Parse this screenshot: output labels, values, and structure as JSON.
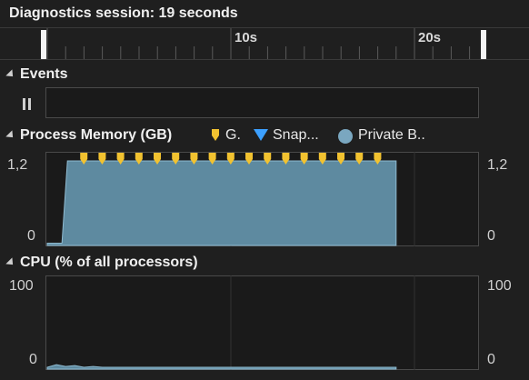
{
  "session": {
    "title": "Diagnostics session: 19 seconds"
  },
  "timeline": {
    "ticks": [
      "10s",
      "20s"
    ]
  },
  "events": {
    "title": "Events"
  },
  "memory": {
    "title": "Process Memory (GB)",
    "legend": [
      {
        "label": "G.",
        "icon": "gc-marker-icon",
        "color": "#f2c230"
      },
      {
        "label": "Snap...",
        "icon": "snapshot-icon",
        "color": "#3ca0ff"
      },
      {
        "label": "Private B..",
        "icon": "private-bytes-icon",
        "color": "#7aa7c0"
      }
    ],
    "y_top_label": "1,2",
    "y_bottom_label": "0",
    "y_top_right_label": "1,2",
    "y_bottom_right_label": "0",
    "gc_marker_count": 17
  },
  "cpu": {
    "title": "CPU (% of all processors)",
    "y_top_label": "100",
    "y_bottom_label": "0",
    "y_top_right_label": "100",
    "y_bottom_right_label": "0"
  },
  "chart_data": [
    {
      "type": "area",
      "title": "Process Memory (GB)",
      "xlabel": "",
      "ylabel": "",
      "ylim": [
        0,
        1.2
      ],
      "series": [
        {
          "name": "Private B..",
          "x": [
            0,
            0.8,
            1.1,
            19
          ],
          "values": [
            0.02,
            0.02,
            1.2,
            1.2
          ]
        }
      ],
      "gc_events_s": [
        1.1,
        2.1,
        3.1,
        4.1,
        5.1,
        6.1,
        7.1,
        8.1,
        9.1,
        10.1,
        11.1,
        12.1,
        13.1,
        14.1,
        15.1,
        16.1,
        17.1
      ]
    },
    {
      "type": "area",
      "title": "CPU (% of all processors)",
      "xlabel": "",
      "ylabel": "",
      "ylim": [
        0,
        100
      ],
      "series": [
        {
          "name": "",
          "x": [
            0,
            0.5,
            1,
            1.5,
            2,
            2.5,
            3,
            4,
            19
          ],
          "values": [
            1,
            4,
            2,
            3,
            1,
            2,
            1,
            1,
            1
          ]
        }
      ]
    }
  ]
}
